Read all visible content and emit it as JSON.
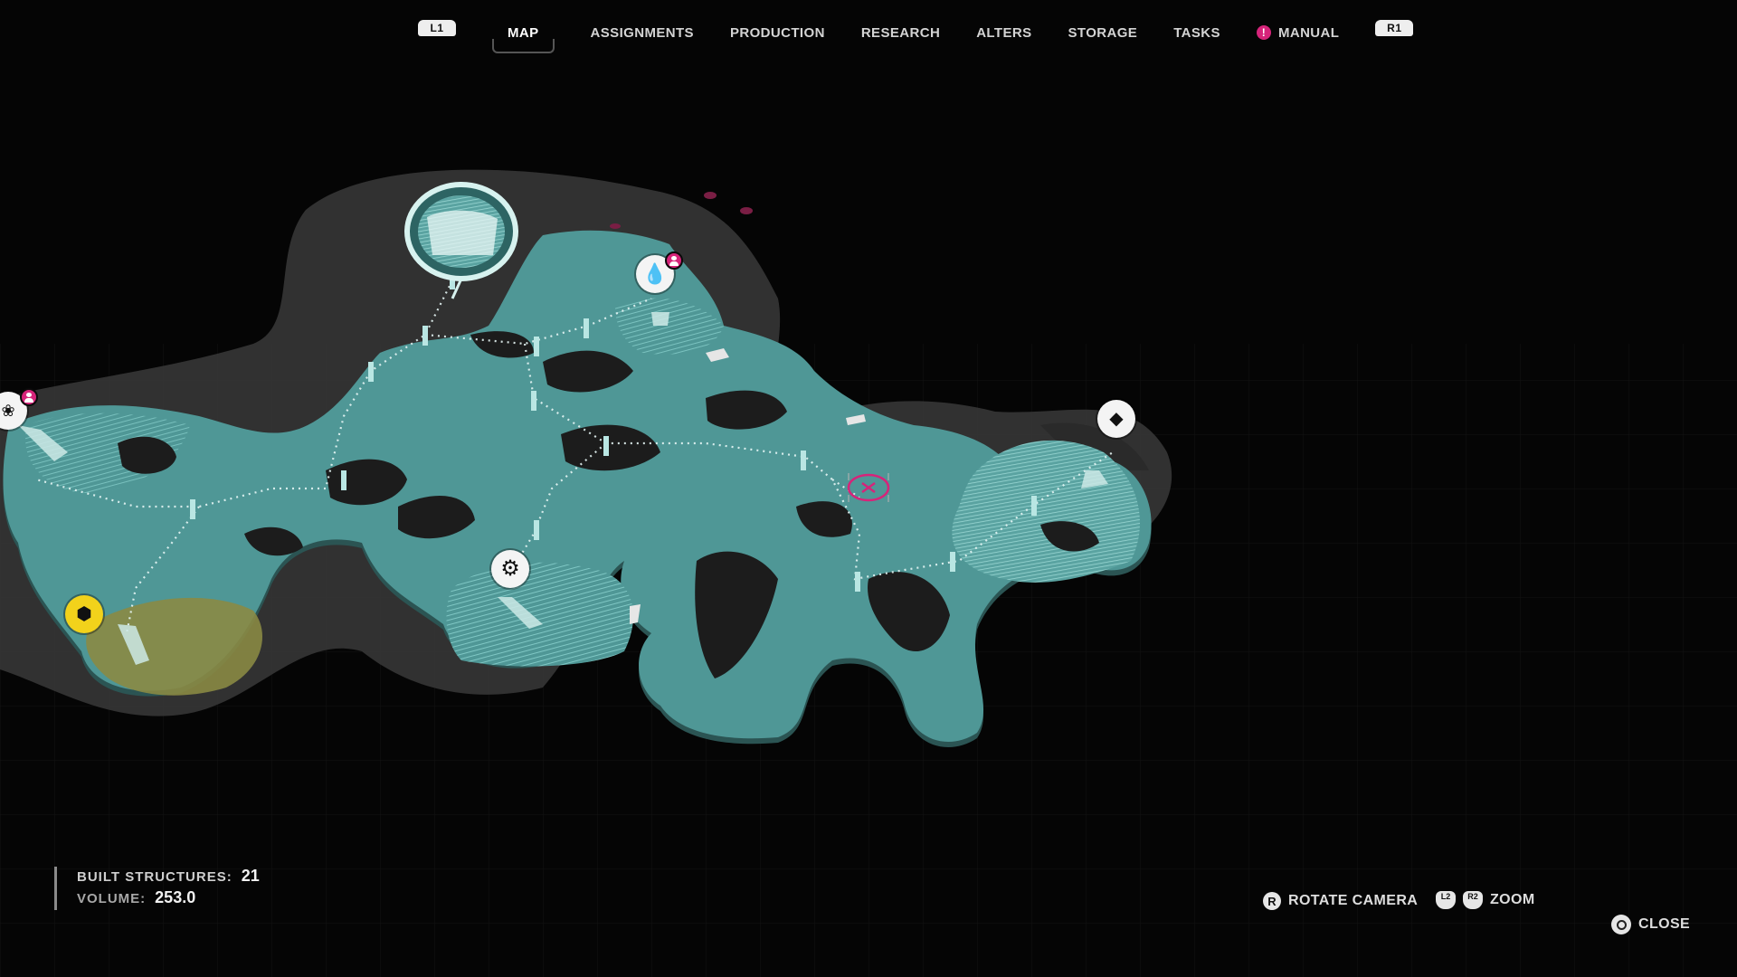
{
  "nav": {
    "left_button": "L1",
    "right_button": "R1",
    "tabs": [
      {
        "label": "MAP",
        "active": true
      },
      {
        "label": "ASSIGNMENTS"
      },
      {
        "label": "PRODUCTION"
      },
      {
        "label": "RESEARCH"
      },
      {
        "label": "ALTERS"
      },
      {
        "label": "STORAGE"
      },
      {
        "label": "TASKS"
      },
      {
        "label": "MANUAL",
        "alert": true
      }
    ],
    "alert_glyph": "!"
  },
  "stats": {
    "built_structures_label": "BUILT STRUCTURES:",
    "built_structures_value": "21",
    "volume_label": "VOLUME:",
    "volume_value": "253.0"
  },
  "controls": {
    "rotate_button": "R",
    "rotate_label": "ROTATE CAMERA",
    "zoom_button_l": "L2",
    "zoom_button_r": "R2",
    "zoom_label": "ZOOM",
    "close_label": "CLOSE"
  },
  "map": {
    "markers": [
      {
        "name": "sensor-dome-marker",
        "icon": "dome-icon"
      },
      {
        "name": "water-marker",
        "icon": "droplet-icon",
        "has_crew_badge": true
      },
      {
        "name": "left-edge-marker",
        "icon": "resource-icon",
        "has_crew_badge": true
      },
      {
        "name": "diamond-marker",
        "icon": "diamond-icon"
      },
      {
        "name": "gear-marker",
        "icon": "gear-icon"
      },
      {
        "name": "yellow-resource-marker",
        "icon": "ore-icon"
      },
      {
        "name": "player-location-marker",
        "icon": "close-x-icon"
      }
    ]
  },
  "colors": {
    "map_fill": "#4f9796",
    "map_stripe": "#7fc7c4",
    "map_edge": "#2b5453",
    "terrain_shadow": "#3a3a3a",
    "yellow_zone": "#8a8a44",
    "accent_pink": "#d6247a",
    "background": "#050505"
  }
}
